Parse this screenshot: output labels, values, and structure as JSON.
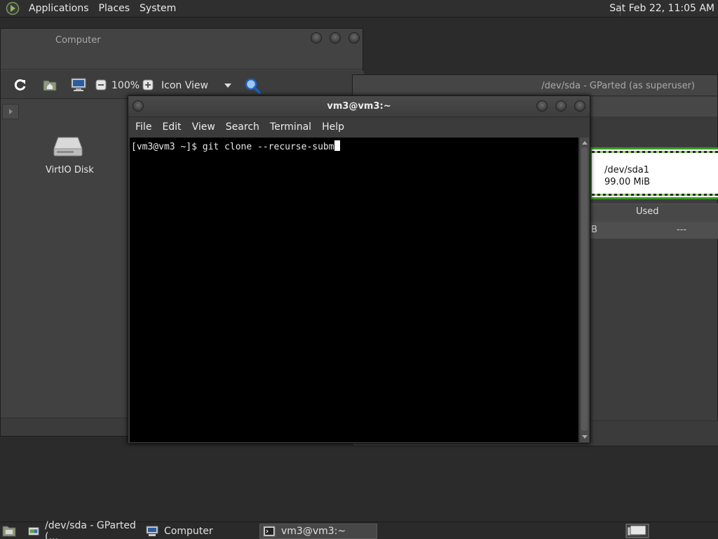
{
  "top_panel": {
    "menus": [
      "Applications",
      "Places",
      "System"
    ],
    "clock": "Sat Feb 22, 11:05 AM"
  },
  "computer_window": {
    "title": "Computer",
    "zoom": "100%",
    "view_mode": "Icon View",
    "items": [
      {
        "label": "VirtIO Disk",
        "icon": "drive-harddisk-icon"
      }
    ]
  },
  "gparted_window": {
    "title": "/dev/sda - GParted (as superuser)",
    "partition": {
      "name": "/dev/sda1",
      "size": "99.00 MiB"
    },
    "columns": {
      "used": "Used"
    },
    "row": {
      "size_tail": "B",
      "used": "---"
    }
  },
  "terminal_window": {
    "title": "vm3@vm3:~",
    "menus": [
      "File",
      "Edit",
      "View",
      "Search",
      "Terminal",
      "Help"
    ],
    "line": "[vm3@vm3 ~]$ git clone --recurse-subm"
  },
  "taskbar": {
    "tasks": [
      {
        "label": "/dev/sda - GParted (...",
        "active": false
      },
      {
        "label": "Computer",
        "active": false
      },
      {
        "label": "vm3@vm3:~",
        "active": true
      }
    ]
  }
}
